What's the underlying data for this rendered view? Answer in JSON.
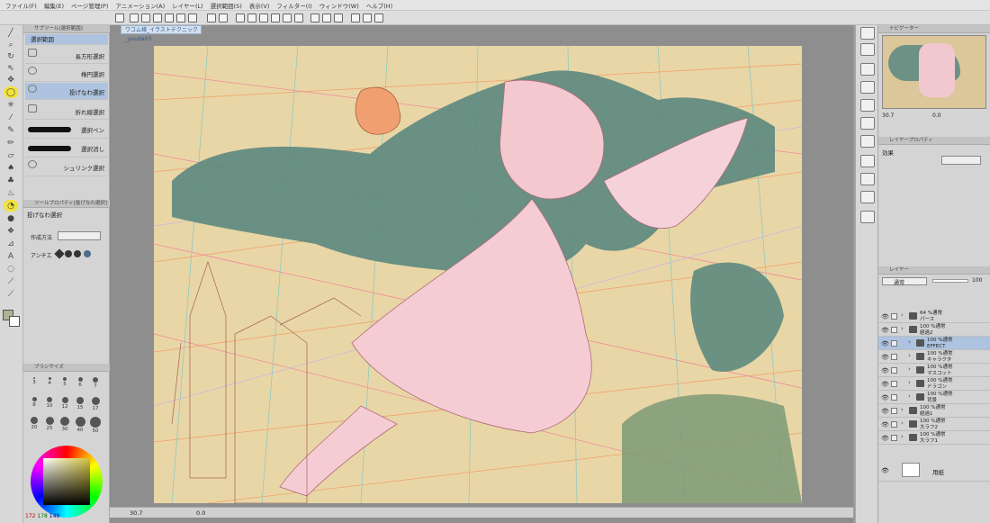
{
  "menu": [
    "ファイル(F)",
    "編集(E)",
    "ページ管理(P)",
    "アニメーション(A)",
    "レイヤー(L)",
    "選択範囲(S)",
    "表示(V)",
    "フィルター(I)",
    "ウィンドウ(W)",
    "ヘルプ(H)"
  ],
  "subtool": {
    "title": "サブツール[選択範囲]",
    "header_item": "選択範囲",
    "items": [
      "長方形選択",
      "楕円選択",
      "投げなわ選択",
      "折れ線選択",
      "選択ペン",
      "選択消し",
      "シュリンク選択"
    ],
    "selected_index": 2
  },
  "tool_property": {
    "title": "ツールプロパティ[投げなわ選択]",
    "name": "投げなわ選択",
    "mode_label": "作成方法",
    "aa_label": "アンチエ"
  },
  "brush_size": {
    "title": "ブラシサイズ",
    "rows": [
      [
        "3",
        "4",
        "5",
        "6",
        "7"
      ],
      [
        "8",
        "10",
        "12",
        "15",
        "17"
      ],
      [
        "20",
        "25",
        "30",
        "40",
        "50"
      ]
    ]
  },
  "color": {
    "r": "172",
    "g": "178",
    "b": "149",
    "fg": "#acb295",
    "bg": "#ffffff"
  },
  "document": {
    "tab_label": "ワコム様_イラストテクニック_yuuda03"
  },
  "status": {
    "zoom": "30.7",
    "angle": "0.0"
  },
  "navigator": {
    "title": "ナビゲーター",
    "zoom": "30.7",
    "angle": "0.0"
  },
  "layer_property": {
    "title": "レイヤープロパティ",
    "effect_label": "効果"
  },
  "layers_panel": {
    "title": "レイヤー",
    "blend": "通常",
    "opacity": "100",
    "layers": [
      {
        "meta": "64 %通常",
        "name": "パース",
        "depth": 0,
        "selected": false
      },
      {
        "meta": "100 %通常",
        "name": "経過2",
        "depth": 0,
        "selected": false
      },
      {
        "meta": "100 %通常",
        "name": "EFFECT",
        "depth": 1,
        "selected": true
      },
      {
        "meta": "100 %通常",
        "name": "キャラクタ",
        "depth": 1,
        "selected": false
      },
      {
        "meta": "100 %通常",
        "name": "マスコット",
        "depth": 1,
        "selected": false
      },
      {
        "meta": "100 %通常",
        "name": "ドラゴン",
        "depth": 1,
        "selected": false
      },
      {
        "meta": "100 %通常",
        "name": "背景",
        "depth": 1,
        "selected": false
      },
      {
        "meta": "100 %通常",
        "name": "経過1",
        "depth": 0,
        "selected": false
      },
      {
        "meta": "100 %通常",
        "name": "大ラフ2",
        "depth": 0,
        "selected": false
      },
      {
        "meta": "100 %通常",
        "name": "大ラフ1",
        "depth": 0,
        "selected": false
      }
    ],
    "paper_label": "用紙"
  }
}
